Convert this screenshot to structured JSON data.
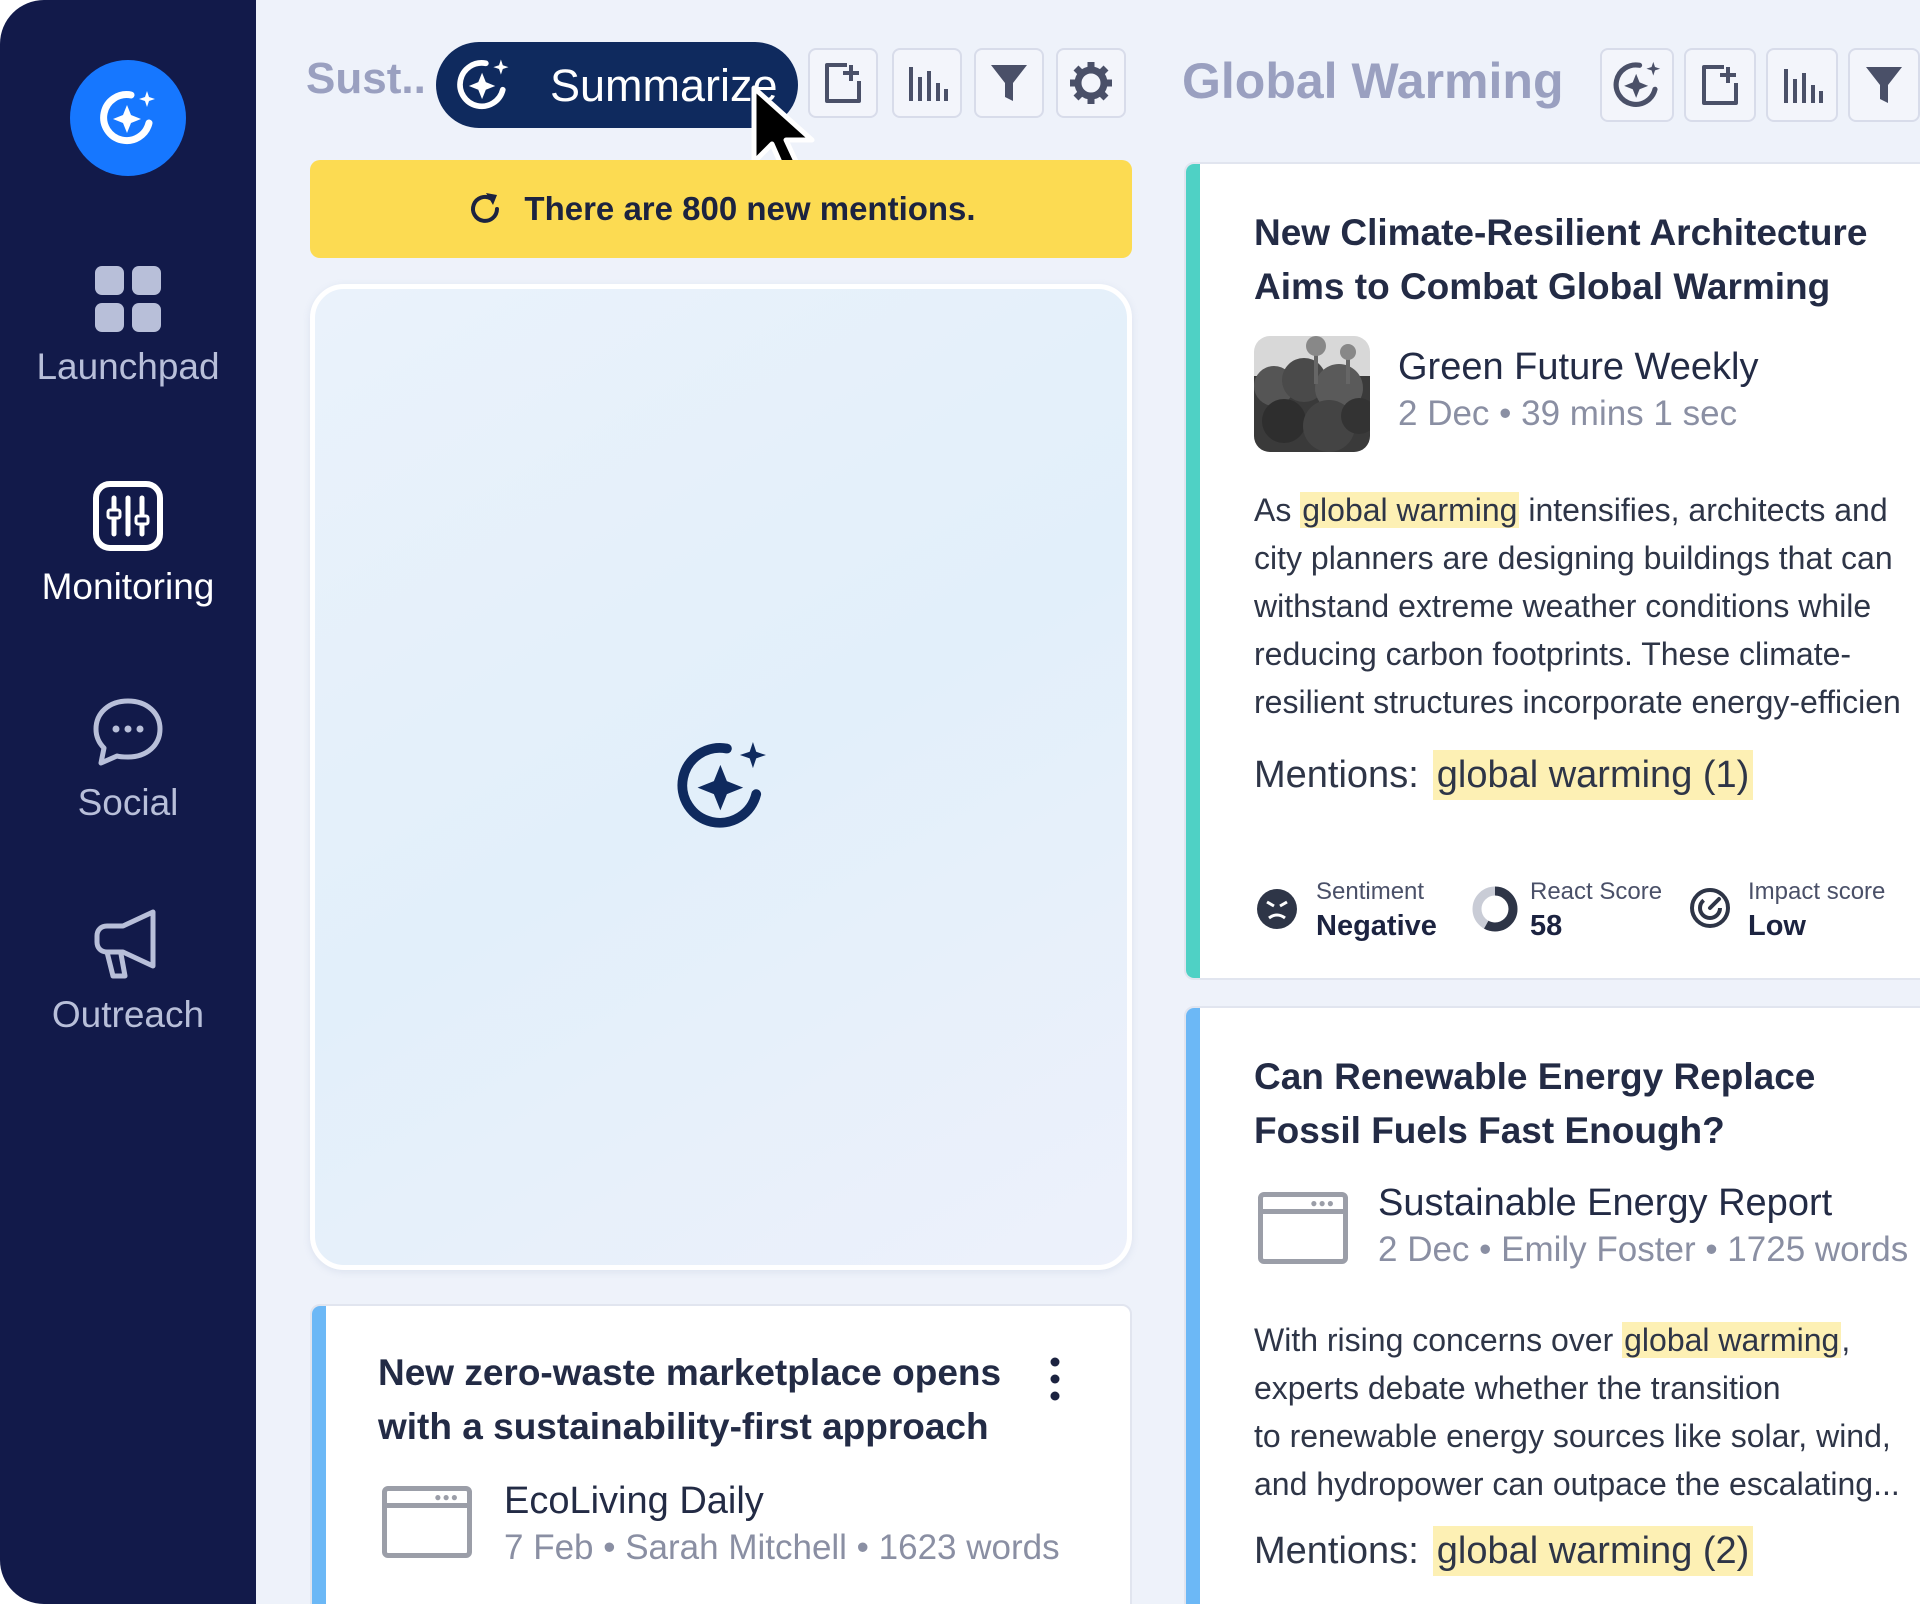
{
  "sidebar": {
    "logo_icon": "ai-sparkle-icon",
    "items": [
      {
        "label": "Launchpad",
        "icon": "grid-icon",
        "active": false
      },
      {
        "label": "Monitoring",
        "icon": "monitoring-icon",
        "active": true
      },
      {
        "label": "Social",
        "icon": "chat-bubble-icon",
        "active": false
      },
      {
        "label": "Outreach",
        "icon": "megaphone-icon",
        "active": false
      }
    ]
  },
  "column_left": {
    "title": "Sust..",
    "summarize_label": "Summarize",
    "tools": [
      "add-report-icon",
      "bar-chart-icon",
      "filter-icon",
      "gear-icon"
    ],
    "banner_text": "There are 800 new mentions.",
    "card": {
      "title_line1": "New zero-waste marketplace opens",
      "title_line2": "with a sustainability-first approach",
      "source": "EcoLiving Daily",
      "meta": "7 Feb • Sarah Mitchell • 1623 words",
      "accent_color": "#6cb8f6"
    }
  },
  "column_right": {
    "title": "Global Warming",
    "tools": [
      "ai-sparkle-icon",
      "add-report-icon",
      "bar-chart-icon",
      "filter-icon"
    ],
    "cards": [
      {
        "title_line1": "New Climate-Resilient Architecture",
        "title_line2": "Aims to Combat Global Warming",
        "source": "Green Future Weekly",
        "meta": "2 Dec • 39 mins 1 sec",
        "body": {
          "l1_pre": "As ",
          "l1_hl": "global warming",
          "l1_post": " intensifies, architects and",
          "l2": "city planners are designing buildings that can",
          "l3": "withstand extreme weather conditions while",
          "l4": "reducing carbon footprints. These climate-",
          "l5": "resilient structures incorporate energy-efficien"
        },
        "mentions_label": "Mentions:",
        "mentions_tag": "global warming (1)",
        "metrics": {
          "sentiment_label": "Sentiment",
          "sentiment_value": "Negative",
          "react_label": "React Score",
          "react_value": "58",
          "impact_label": "Impact score",
          "impact_value": "Low"
        },
        "react_fraction": 0.58,
        "accent_color": "#4fd1c5"
      },
      {
        "title_line1": "Can Renewable Energy Replace",
        "title_line2": "Fossil Fuels Fast Enough?",
        "source": "Sustainable Energy Report",
        "meta": "2 Dec • Emily Foster • 1725 words",
        "body": {
          "l1_pre": "With rising concerns over ",
          "l1_hl": "global warming",
          "l1_post": ",",
          "l2": "experts debate whether the transition",
          "l3": "to renewable energy sources like solar, wind,",
          "l4": "and hydropower can outpace the escalating..."
        },
        "mentions_label": "Mentions:",
        "mentions_tag": "global warming (2)",
        "accent_color": "#6cb8f6"
      }
    ]
  },
  "colors": {
    "sidebar_bg": "#121a4a",
    "accent_blue": "#1677ff",
    "summarize_bg": "#0f2a5e",
    "banner_yellow": "#fcdb52",
    "highlight": "#fdf0b4"
  }
}
